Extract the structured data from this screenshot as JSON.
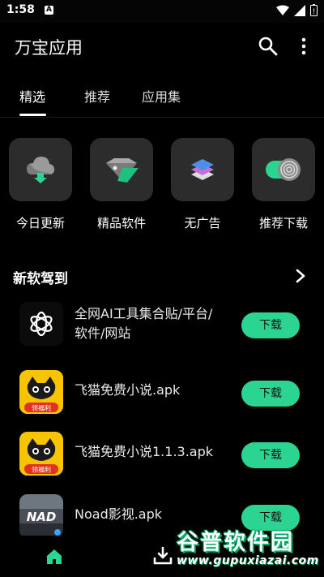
{
  "status_bar": {
    "time": "1:58",
    "notification_letter": "A"
  },
  "app_bar": {
    "title": "万宝应用"
  },
  "tabs": [
    {
      "label": "精选",
      "active": true
    },
    {
      "label": "推荐",
      "active": false
    },
    {
      "label": "应用集",
      "active": false
    }
  ],
  "categories": [
    {
      "label": "今日更新",
      "icon": "cloud-download-icon"
    },
    {
      "label": "精品软件",
      "icon": "gem-icon"
    },
    {
      "label": "无广告",
      "icon": "layers-icon"
    },
    {
      "label": "推荐下载",
      "icon": "toggle-icon"
    }
  ],
  "section": {
    "title": "新软驾到"
  },
  "apps": [
    {
      "name_line1": "全网AI工具集合贴/平台/",
      "name_line2": "软件/网站",
      "button": "下载",
      "icon": "openai-logo-icon"
    },
    {
      "name_line1": "飞猫免费小说.apk",
      "name_line2": "",
      "button": "下载",
      "icon": "cat-app-icon",
      "badge": "领福利"
    },
    {
      "name_line1": "飞猫免费小说1.1.3.apk",
      "name_line2": "",
      "button": "下载",
      "icon": "cat-app-icon",
      "badge": "领福利"
    },
    {
      "name_line1": "Noad影视.apk",
      "name_line2": "",
      "button": "下载",
      "icon": "noad-app-icon",
      "badge": "NAD"
    }
  ],
  "watermark": {
    "top": "谷普软件园",
    "bottom": "www.gupuxiazai.com"
  },
  "colors": {
    "accent": "#2bd591",
    "background": "#000000",
    "tile": "#2c2c2c"
  }
}
